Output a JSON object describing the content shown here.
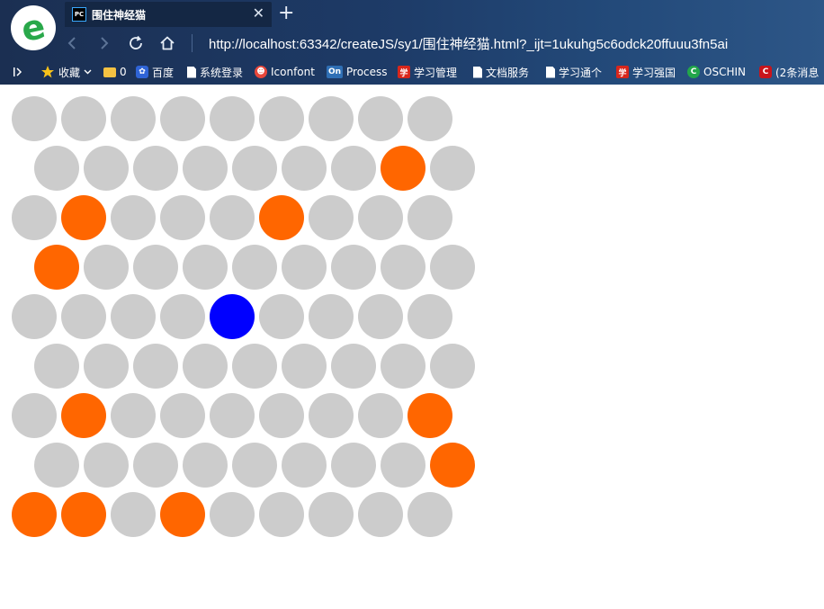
{
  "browser": {
    "tab": {
      "icon_text": "PC",
      "title": "围住神经猫"
    },
    "address": "http://localhost:63342/createJS/sy1/围住神经猫.html?_ijt=1ukuhg5c6odck20ffuuu3fn5ai",
    "bookmarks": [
      {
        "icon": "star-icon",
        "label": "收藏"
      },
      {
        "icon": "folder-icon",
        "label": "0"
      },
      {
        "icon": "baidu-icon",
        "label": "百度"
      },
      {
        "icon": "page-icon",
        "label": "系统登录"
      },
      {
        "icon": "iconfont-icon",
        "label": "Iconfont"
      },
      {
        "icon": "processon-icon",
        "label": "Process"
      },
      {
        "icon": "xuexi-icon",
        "label": "学习管理"
      },
      {
        "icon": "page-icon",
        "label": "文档服务"
      },
      {
        "icon": "page-icon",
        "label": "学习通个"
      },
      {
        "icon": "xuexi-icon",
        "label": "学习强国"
      },
      {
        "icon": "oschina-icon",
        "label": "OSCHIN"
      },
      {
        "icon": "csdn-icon",
        "label": "(2条消息"
      }
    ]
  },
  "colors": {
    "empty": "#cccccc",
    "blocked": "#ff6600",
    "cat": "#0000ff"
  },
  "grid": {
    "rows": 9,
    "cols": 9,
    "cells": [
      [
        "empty",
        "empty",
        "empty",
        "empty",
        "empty",
        "empty",
        "empty",
        "empty",
        "empty"
      ],
      [
        "empty",
        "empty",
        "empty",
        "empty",
        "empty",
        "empty",
        "empty",
        "blocked",
        "empty"
      ],
      [
        "empty",
        "blocked",
        "empty",
        "empty",
        "empty",
        "blocked",
        "empty",
        "empty",
        "empty"
      ],
      [
        "blocked",
        "empty",
        "empty",
        "empty",
        "empty",
        "empty",
        "empty",
        "empty",
        "empty"
      ],
      [
        "empty",
        "empty",
        "empty",
        "empty",
        "cat",
        "empty",
        "empty",
        "empty",
        "empty"
      ],
      [
        "empty",
        "empty",
        "empty",
        "empty",
        "empty",
        "empty",
        "empty",
        "empty",
        "empty"
      ],
      [
        "empty",
        "blocked",
        "empty",
        "empty",
        "empty",
        "empty",
        "empty",
        "empty",
        "blocked"
      ],
      [
        "empty",
        "empty",
        "empty",
        "empty",
        "empty",
        "empty",
        "empty",
        "empty",
        "blocked"
      ],
      [
        "blocked",
        "blocked",
        "empty",
        "blocked",
        "empty",
        "empty",
        "empty",
        "empty",
        "empty"
      ]
    ]
  }
}
